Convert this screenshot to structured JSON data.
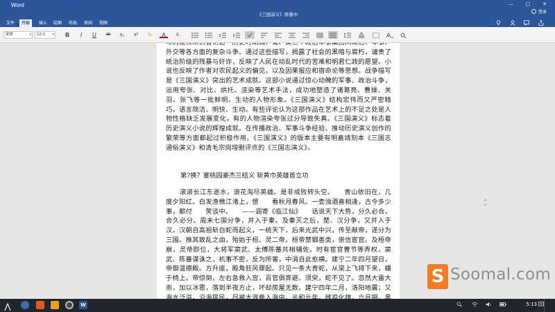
{
  "titlebar": {
    "app_name": "Word",
    "document_title": "《三国演义》原著中",
    "user": "登录",
    "share": "共享",
    "minimize_glyph": "—",
    "maximize_glyph": "□",
    "close_glyph": "✕",
    "accent": "#2b579a"
  },
  "tabs": {
    "items": [
      "文件",
      "开始",
      "插入",
      "绘图",
      "布局",
      "审阅",
      "视图"
    ],
    "active": "开始",
    "right_icons": [
      "lightbulb-icon",
      "user-icon",
      "comment-icon",
      "share-icon"
    ]
  },
  "toolbar": {
    "font_name": "宋体",
    "font_size": "10.5",
    "bold": "B",
    "italic": "I",
    "underline": "U",
    "strikethrough": "ab",
    "subscript": "x₂",
    "superscript": "x²",
    "highlight": "✎",
    "font_color": "A",
    "clear_format": "A",
    "dropdown_glyph": "▾"
  },
  "document": {
    "paragraph_top": "与的是汉末到晋初这一历史时期魏、蜀、吴三个政治军事集团间政治、军事、外交等各方面的复杂斗争。通过这些描写，揭露了社会的黑暗与腐朽，谴责了统治阶级的残暴与奸诈，反映了人民在动乱时代的苦难和明君仁政的愿望。小说也反映了作者对农民起义的偏见，以及因果报应和宿命论等思想。战争描写是《三国演义》突出的艺术成就。这部小说通过惊心动魄的军事、政治斗争，运用夸张、对比、烘托、渲染等艺术手法，成功地塑造了诸葛亮、曹操、关羽、张飞等一批鲜明、生动的人物形象。《三国演义》结构宏伟而又严密精巧，语言简洁、明快、生动。有些评论认为这部作品在艺术上的不足之处是人物性格缺乏发展变化，有的人物渲染夸张过分导致失真。《三国演义》标志着历史演义小说的辉煌成就。在传播政治、军事斗争经验、推动历史演义创作的繁荣等方面都起过积极作用。《三国演义》的版本主要有明嘉靖刻本《三国志通俗演义》和清毛宗岗增删评点的《三国志演义》。",
    "ellipsis": "...",
    "chapter_title": "第?换？宴桃园豪杰三结义  斩黄巾英雄首立功",
    "paragraph_body": "滚滚长江东逝水，浪花淘尽英雄。是非成败转头空。　　青山依旧在，几度夕阳红。白发渔樵江渚上，惯　　看秋月春风。一壶浊酒喜相逢，古今多少事，都付　　笑谈中。　　——调寄《临江仙》　　话说天下大势，分久必合，合久必分。周末七国分争，并入于秦。及秦灭之后，楚、汉分争，又并入于汉。汉朝自高祖斩白蛇而起义，一统天下，后来光武中兴，传至献帝，遂分为三国。推其致乱之由，殆始于桓、灵二帝。桓帝禁锢善类，崇信宦官。及桓帝崩，灵帝即位，大将军窦武、太傅陈蕃共相辅佐。时有宦官曹节等弄权，窦武、陈蕃谋诛之，机事不密，反为所害，中涓自此愈横。建宁二年四月望日，帝御温德殿。方升座，殿角狂风骤起。只见一条大青蛇，从梁上飞将下来，蟠于椅上。帝惊倒，左右急救入宫，百官俱奔避。须臾，蛇不见了。忽然大雷大雨，加以冰雹，落到半夜方止，坏却房屋无数。建宁四年二月，洛阳地震；又海水泛溢，沿海居民，尽被大浪卷入海中。光和元年，雌鸡化雄。六月朔，黑气十余丈，飞入温德殿中。秋七月，有虹现于玉堂。"
  },
  "taskbar": {
    "time": "5:13",
    "tray_icons": [
      "search-icon",
      "network-icon",
      "volume-icon",
      "battery-icon",
      "notification-icon"
    ]
  },
  "watermark": {
    "logo_letter": "S",
    "text": "Soomal.com",
    "color": "#f47c20"
  }
}
